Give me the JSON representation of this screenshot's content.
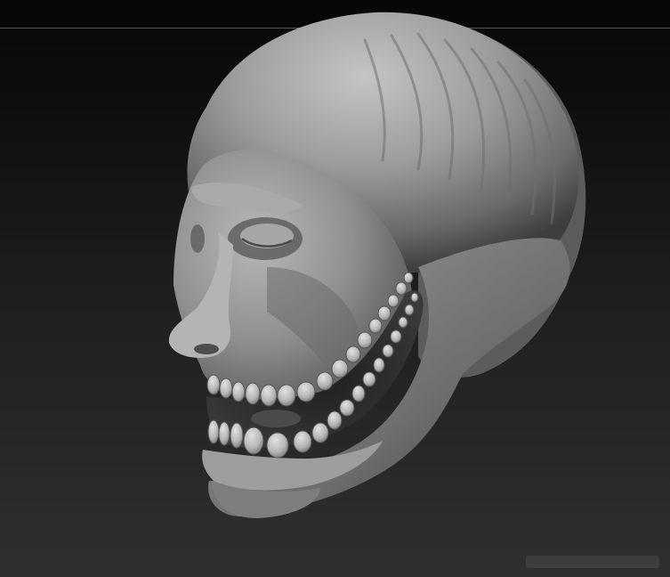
{
  "scene": {
    "subject": "sculpted-head",
    "colors": {
      "background_top": "#080808",
      "background_bottom": "#2f2f2f",
      "horizon_line": "#5a5a5a",
      "clay_light": "#bdbdbd",
      "clay_mid": "#8a8a8a",
      "clay_dark": "#3a3a3a",
      "teeth": "#c9c9c9"
    }
  }
}
